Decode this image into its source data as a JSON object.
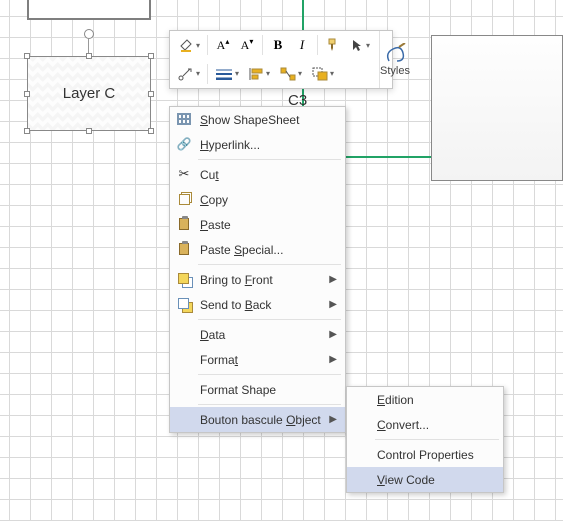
{
  "canvas": {
    "layer_c_text": "Layer C",
    "connector_label": "C3"
  },
  "minibar": {
    "styles": "Styles"
  },
  "menu": {
    "items": [
      {
        "u": "S",
        "rest": "how ShapeSheet"
      },
      {
        "u": "H",
        "rest": "yperlink..."
      },
      {
        "pre": "Cu",
        "u": "t"
      },
      {
        "u": "C",
        "rest": "opy"
      },
      {
        "u": "P",
        "rest": "aste"
      },
      {
        "pre": "Paste ",
        "u": "S",
        "rest": "pecial..."
      },
      {
        "pre": "Bring to ",
        "u": "F",
        "rest": "ront"
      },
      {
        "pre": "Send to ",
        "u": "B",
        "rest": "ack"
      },
      {
        "u": "D",
        "rest": "ata"
      },
      {
        "pre": "Forma",
        "u": "t"
      },
      {
        "label": "Format Shape"
      },
      {
        "pre": "Bouton bascule ",
        "u": "O",
        "rest": "bject"
      }
    ]
  },
  "submenu": {
    "items": [
      {
        "u": "E",
        "rest": "dition"
      },
      {
        "u": "C",
        "rest": "onvert..."
      },
      {
        "label": "Control Properties"
      },
      {
        "u": "V",
        "rest": "iew Code"
      }
    ]
  }
}
